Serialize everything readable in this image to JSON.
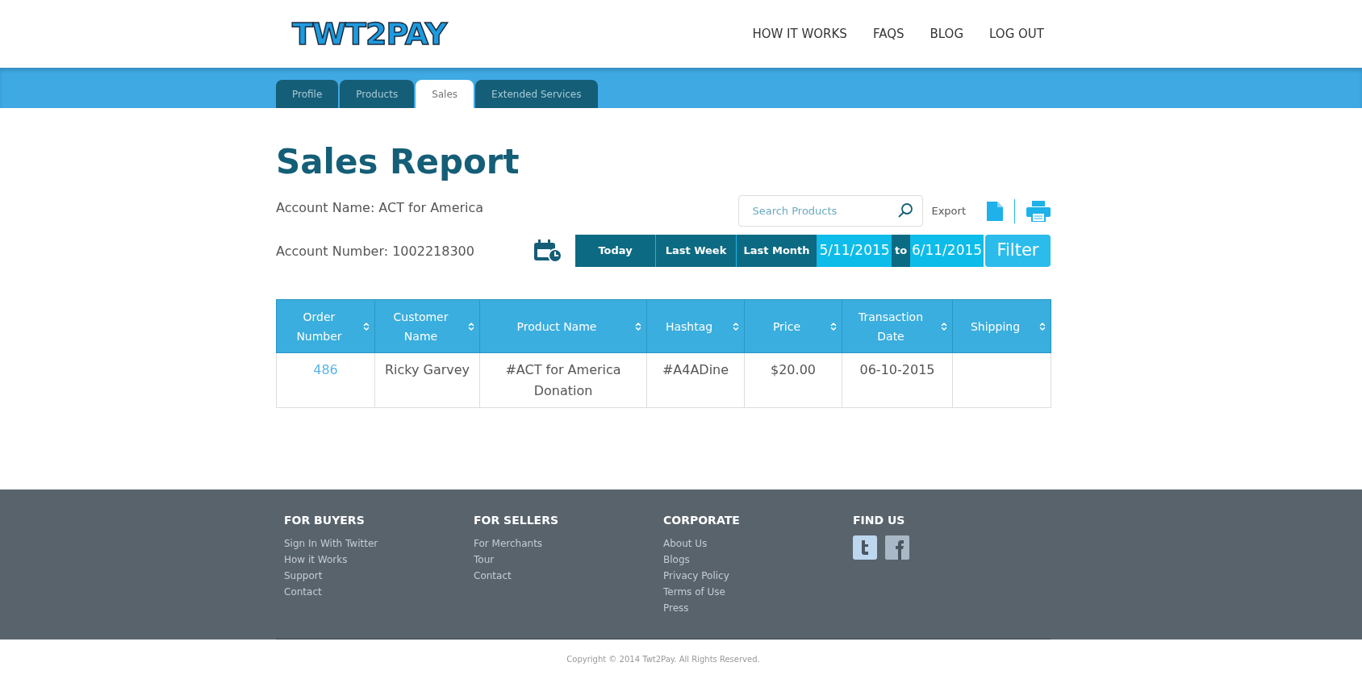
{
  "header": {
    "logo": "TWT2PAY",
    "nav": [
      "HOW IT WORKS",
      "FAQS",
      "BLOG",
      "LOG OUT"
    ]
  },
  "tabs": [
    {
      "label": "Profile",
      "selected": false
    },
    {
      "label": "Products",
      "selected": false
    },
    {
      "label": "Sales",
      "selected": true
    },
    {
      "label": "Extended Services",
      "selected": false
    }
  ],
  "title": "Sales Report",
  "account_name": "Account Name: ACT for America",
  "account_number": "Account Number: 1002218300",
  "search": {
    "placeholder": "Search Products"
  },
  "export_label": "Export",
  "date_filter": {
    "presets": [
      "Today",
      "Last Week",
      "Last Month"
    ],
    "from": "5/11/2015",
    "separator": "to",
    "to": "6/11/2015",
    "button": "Filter"
  },
  "table": {
    "columns": [
      {
        "label": "Order Number"
      },
      {
        "label": "Customer Name"
      },
      {
        "label": "Product Name"
      },
      {
        "label": "Hashtag"
      },
      {
        "label": "Price"
      },
      {
        "label": "Transaction Date"
      },
      {
        "label": "Shipping"
      }
    ],
    "rows": [
      {
        "cells": [
          "486",
          "Ricky Garvey",
          "#ACT for America Donation",
          "#A4ADine",
          "$20.00",
          "06-10-2015",
          ""
        ]
      }
    ]
  },
  "footer": {
    "columns": [
      {
        "heading": "FOR BUYERS",
        "kind": "links",
        "links": [
          "Sign In With Twitter",
          "How it Works",
          "Support",
          "Contact"
        ]
      },
      {
        "heading": "FOR SELLERS",
        "kind": "links",
        "links": [
          "For Merchants",
          "Tour",
          "Contact"
        ]
      },
      {
        "heading": "CORPORATE",
        "kind": "links",
        "links": [
          "About Us",
          "Blogs",
          "Privacy Policy",
          "Terms of Use",
          "Press"
        ]
      },
      {
        "heading": "FIND US",
        "kind": "social"
      }
    ],
    "copyright": "Copyright © 2014 Twt2Pay. All Rights Reserved."
  }
}
